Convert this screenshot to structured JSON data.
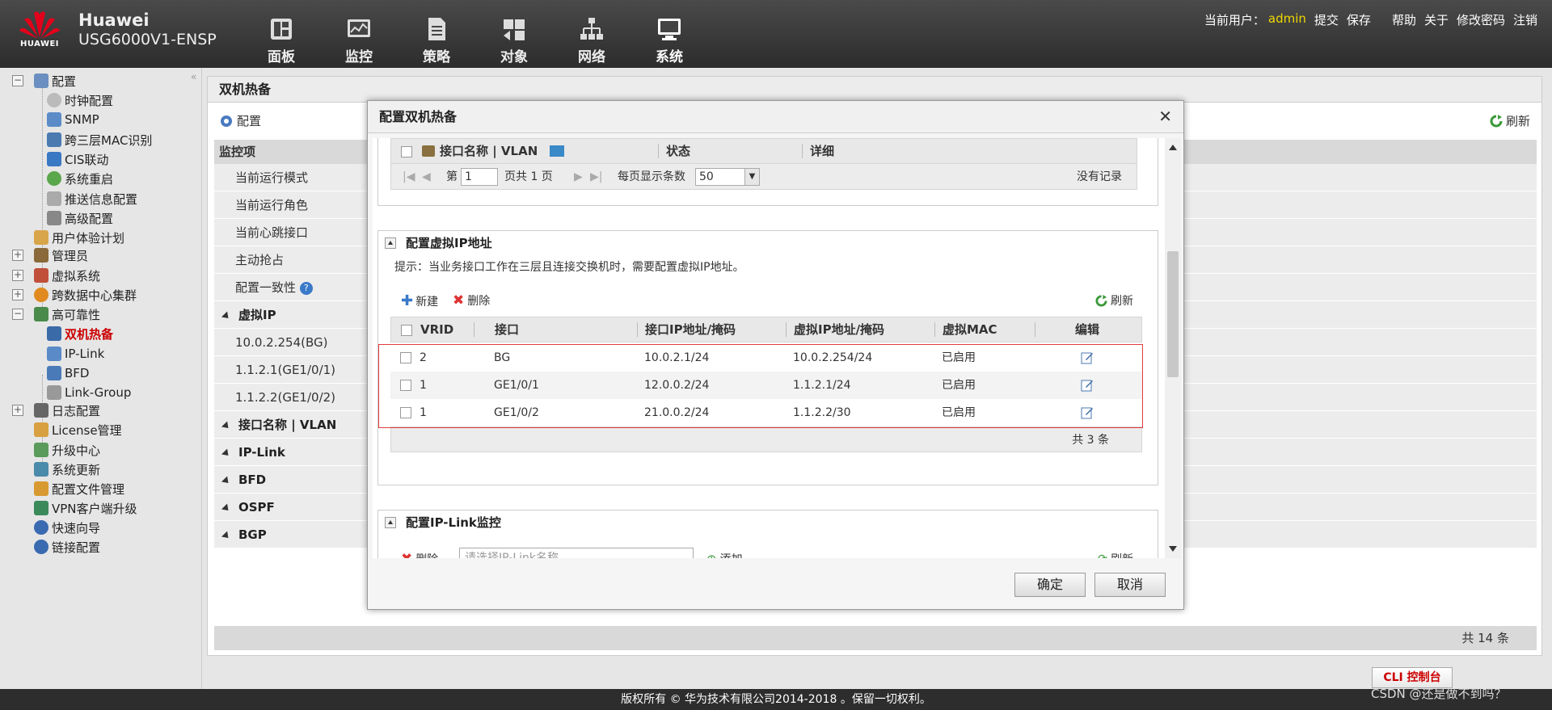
{
  "header": {
    "logo_text": "HUAWEI",
    "brand": "Huawei",
    "model": "USG6000V1-ENSP",
    "nav": [
      "面板",
      "监控",
      "策略",
      "对象",
      "网络",
      "系统"
    ],
    "current_user_label": "当前用户：",
    "current_user": "admin",
    "actions": [
      "提交",
      "保存",
      "帮助",
      "关于",
      "修改密码",
      "注销"
    ]
  },
  "sidebar": {
    "items": [
      {
        "label": "配置",
        "top": 0
      },
      {
        "label": "时钟配置"
      },
      {
        "label": "SNMP"
      },
      {
        "label": "跨三层MAC识别"
      },
      {
        "label": "CIS联动"
      },
      {
        "label": "系统重启"
      },
      {
        "label": "推送信息配置"
      },
      {
        "label": "高级配置"
      },
      {
        "label": "用户体验计划"
      },
      {
        "label": "管理员"
      },
      {
        "label": "虚拟系统"
      },
      {
        "label": "跨数据中心集群"
      },
      {
        "label": "高可靠性"
      },
      {
        "label": "双机热备"
      },
      {
        "label": "IP-Link"
      },
      {
        "label": "BFD"
      },
      {
        "label": "Link-Group"
      },
      {
        "label": "日志配置"
      },
      {
        "label": "License管理"
      },
      {
        "label": "升级中心"
      },
      {
        "label": "系统更新"
      },
      {
        "label": "配置文件管理"
      },
      {
        "label": "VPN客户端升级"
      },
      {
        "label": "快速向导"
      },
      {
        "label": "链接配置"
      }
    ]
  },
  "main": {
    "title": "双机热备",
    "config_label": "配置",
    "refresh_label": "刷新",
    "monitor_header": "监控项",
    "rows": [
      "当前运行模式",
      "当前运行角色",
      "当前心跳接口",
      "主动抢占",
      "配置一致性",
      "虚拟IP",
      "10.0.2.254(BG)",
      "1.1.2.1(GE1/0/1)",
      "1.1.2.2(GE1/0/2)",
      "接口名称 | VLAN",
      "IP-Link",
      "BFD",
      "OSPF",
      "BGP"
    ],
    "footer_total": "共 14 条"
  },
  "dialog": {
    "title": "配置双机热备",
    "iface_grid": {
      "headers": [
        "接口名称 | VLAN",
        "状态",
        "详细"
      ],
      "pager": {
        "page_label": "第",
        "page": "1",
        "total_pages": "页共 1 页",
        "per_page_label": "每页显示条数",
        "per_page": "50",
        "no_records": "没有记录"
      }
    },
    "vip_section": {
      "title": "配置虚拟IP地址",
      "hint": "提示：当业务接口工作在三层且连接交换机时，需要配置虚拟IP地址。",
      "new_label": "新建",
      "delete_label": "删除",
      "refresh_label": "刷新",
      "headers": [
        "VRID",
        "接口",
        "接口IP地址/掩码",
        "虚拟IP地址/掩码",
        "虚拟MAC",
        "编辑"
      ],
      "rows": [
        {
          "vrid": "2",
          "iface": "BG",
          "ip": "10.0.2.1/24",
          "vip": "10.0.2.254/24",
          "mac": "已启用"
        },
        {
          "vrid": "1",
          "iface": "GE1/0/1",
          "ip": "12.0.0.2/24",
          "vip": "1.1.2.1/24",
          "mac": "已启用"
        },
        {
          "vrid": "1",
          "iface": "GE1/0/2",
          "ip": "21.0.0.2/24",
          "vip": "1.1.2.2/30",
          "mac": "已启用"
        }
      ],
      "total": "共 3 条"
    },
    "iplink_section": {
      "title": "配置IP-Link监控",
      "delete_label": "删除",
      "select_placeholder": "请选择IP-Link名称",
      "add_label": "添加",
      "refresh_label": "刷新"
    },
    "ok_label": "确定",
    "cancel_label": "取消"
  },
  "footer": {
    "copyright": "版权所有 © 华为技术有限公司2014-2018 。保留一切权利。",
    "cli_label": "CLI 控制台",
    "watermark": "CSDN @还是做不到吗？"
  }
}
